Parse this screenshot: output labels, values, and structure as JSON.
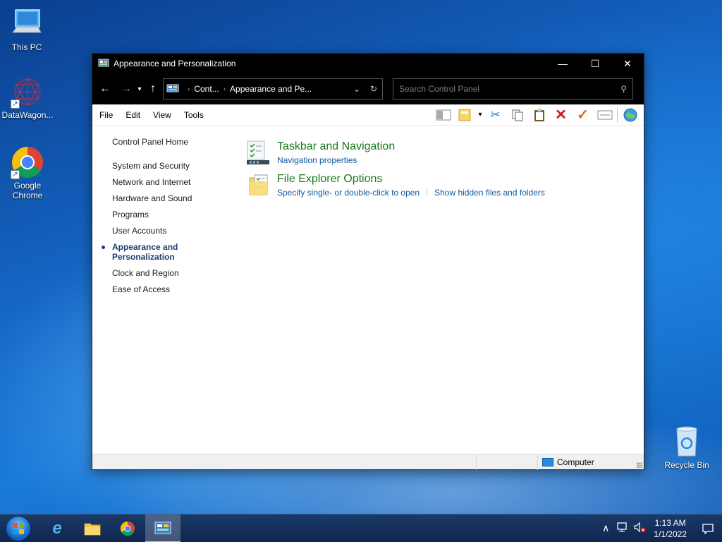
{
  "desktop": {
    "icons": [
      {
        "label": "This PC"
      },
      {
        "label": "DataWagon..."
      },
      {
        "label": "Google Chrome"
      },
      {
        "label": "Recycle Bin"
      }
    ]
  },
  "window": {
    "title": "Appearance and Personalization",
    "controls": {
      "minimize": "—",
      "maximize": "☐",
      "close": "✕"
    },
    "address": {
      "crumbs": [
        "Cont...",
        "Appearance and Pe..."
      ],
      "separator": "›"
    },
    "search": {
      "placeholder": "Search Control Panel"
    },
    "menu": [
      "File",
      "Edit",
      "View",
      "Tools"
    ],
    "leftnav": {
      "home": "Control Panel Home",
      "items": [
        {
          "label": "System and Security"
        },
        {
          "label": "Network and Internet"
        },
        {
          "label": "Hardware and Sound"
        },
        {
          "label": "Programs"
        },
        {
          "label": "User Accounts"
        },
        {
          "label": "Appearance and Personalization",
          "active": true
        },
        {
          "label": "Clock and Region"
        },
        {
          "label": "Ease of Access"
        }
      ]
    },
    "categories": [
      {
        "title": "Taskbar and Navigation",
        "icon": "taskbar-icon",
        "links": [
          "Navigation properties"
        ]
      },
      {
        "title": "File Explorer Options",
        "icon": "folder-options-icon",
        "links": [
          "Specify single- or double-click to open",
          "Show hidden files and folders"
        ]
      }
    ],
    "status": {
      "computer": "Computer"
    }
  },
  "taskbar": {
    "clock": {
      "time": "1:13 AM",
      "date": "1/1/2022"
    }
  }
}
